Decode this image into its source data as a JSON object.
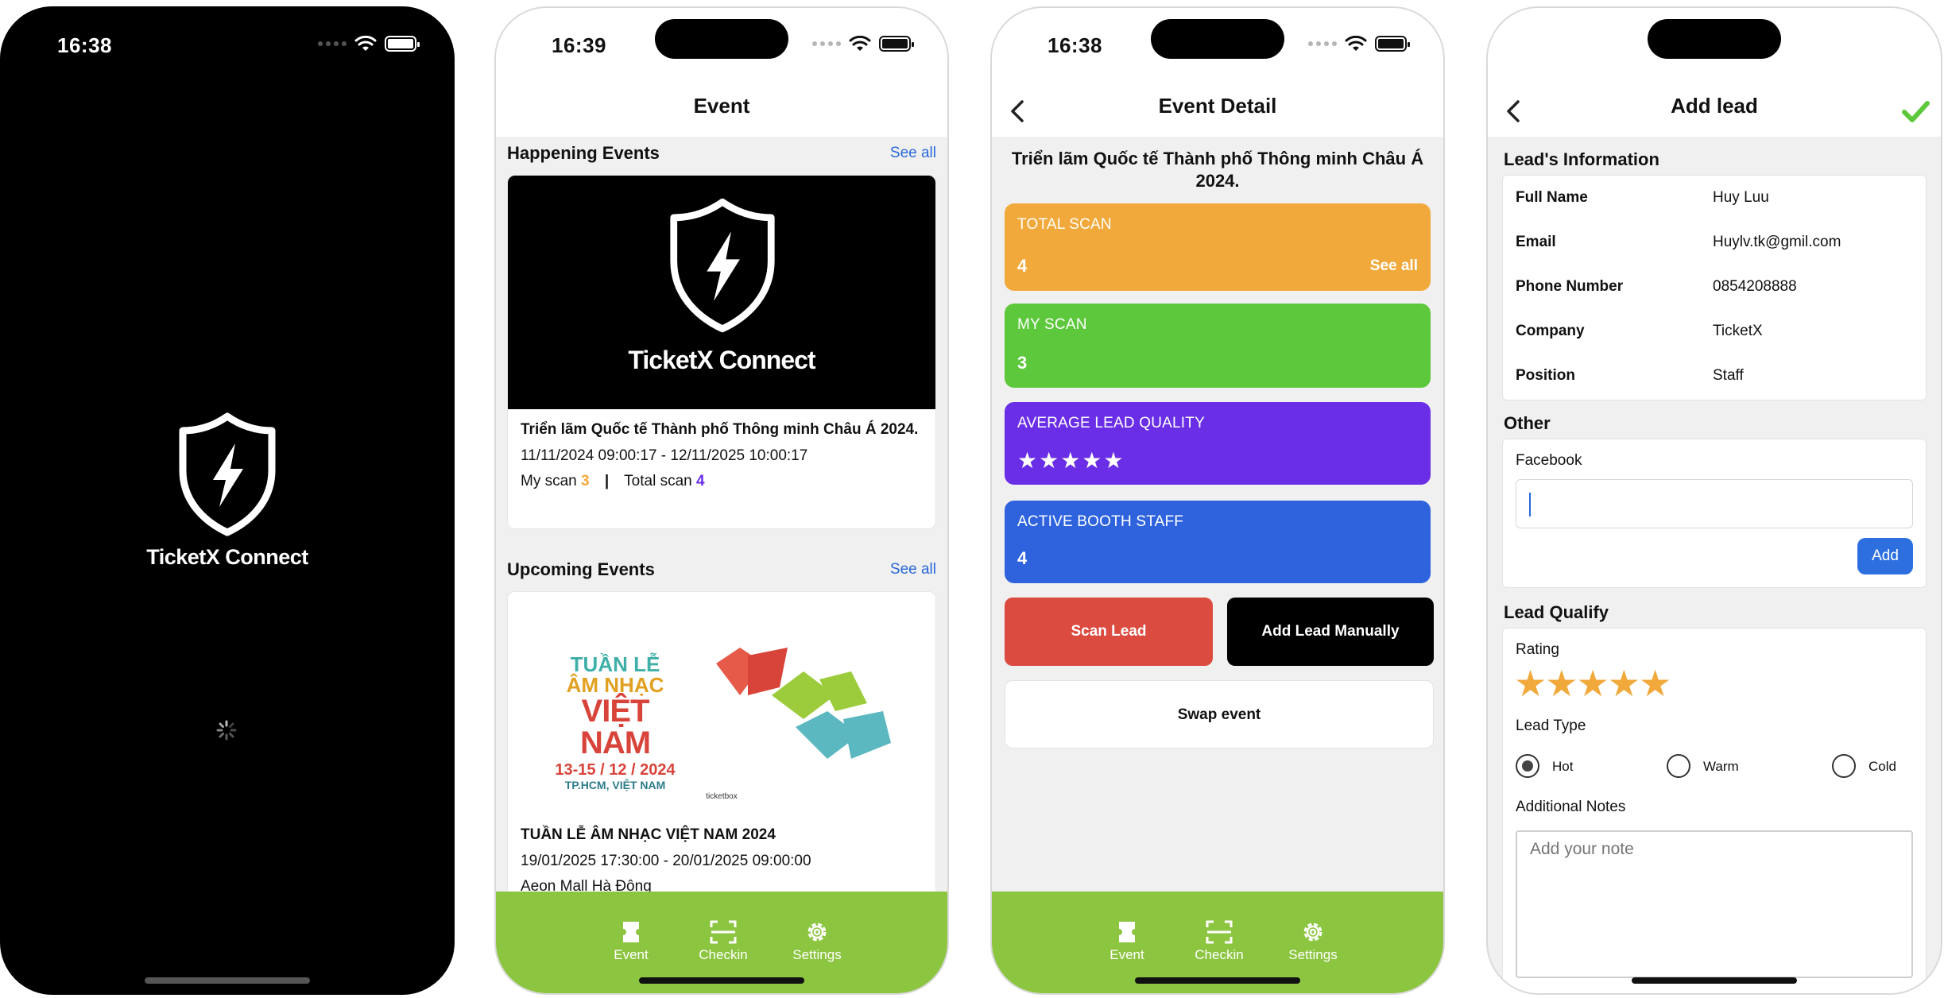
{
  "screen1": {
    "time": "16:38",
    "brand": "TicketX Connect"
  },
  "screen2": {
    "time": "16:39",
    "title": "Event",
    "happening": {
      "heading": "Happening Events",
      "see_all": "See all",
      "banner_brand": "TicketX Connect",
      "event_name": "Triển lãm Quốc tế Thành phố Thông minh Châu Á 2024.",
      "datetime": "11/11/2024 09:00:17 - 12/11/2025 10:00:17",
      "my_scan_label": "My scan",
      "my_scan_value": "3",
      "total_scan_label": "Total scan",
      "total_scan_value": "4",
      "separator": "|"
    },
    "upcoming": {
      "heading": "Upcoming Events",
      "see_all": "See all",
      "poster_line1": "TUẦN LỄ",
      "poster_line2": "ÂM NHẠC",
      "poster_line3": "VIỆT NAM",
      "poster_dates": "13-15 / 12 / 2024",
      "poster_place": "TP.HCM, VIỆT NAM",
      "poster_small": "ticketbox",
      "event_name": "TUẦN LỄ ÂM NHẠC VIỆT NAM 2024",
      "datetime": "19/01/2025 17:30:00 - 20/01/2025 09:00:00",
      "location_partial": "Aeon Mall Hà Đông"
    },
    "tabs": [
      {
        "label": "Event",
        "icon": "ticket-icon"
      },
      {
        "label": "Checkin",
        "icon": "scan-icon"
      },
      {
        "label": "Settings",
        "icon": "gear-icon"
      }
    ]
  },
  "screen3": {
    "time": "16:38",
    "title": "Event Detail",
    "event_name": "Triển lãm Quốc tế Thành phố Thông minh Châu Á 2024.",
    "total_scan": {
      "label": "TOTAL SCAN",
      "value": "4",
      "see_all": "See all",
      "color": "#f2a93b"
    },
    "my_scan": {
      "label": "MY SCAN",
      "value": "3",
      "color": "#5dc83c"
    },
    "avg_quality": {
      "label": "AVERAGE LEAD QUALITY",
      "stars": "★★★★★",
      "rating": 5,
      "color": "#6a2ee6"
    },
    "booth_staff": {
      "label": "ACTIVE BOOTH STAFF",
      "value": "4",
      "color": "#2e63dd"
    },
    "scan_lead": "Scan Lead",
    "add_manual": "Add Lead Manually",
    "swap_event": "Swap event",
    "tabs": [
      {
        "label": "Event",
        "icon": "ticket-icon"
      },
      {
        "label": "Checkin",
        "icon": "scan-icon"
      },
      {
        "label": "Settings",
        "icon": "gear-icon"
      }
    ]
  },
  "screen4": {
    "title": "Add lead",
    "info_heading": "Lead's Information",
    "info": [
      {
        "key": "Full Name",
        "value": "Huy Luu"
      },
      {
        "key": "Email",
        "value": "Huylv.tk@gmil.com"
      },
      {
        "key": "Phone Number",
        "value": "0854208888"
      },
      {
        "key": "Company",
        "value": "TicketX"
      },
      {
        "key": "Position",
        "value": "Staff"
      }
    ],
    "other_heading": "Other",
    "facebook_label": "Facebook",
    "facebook_value": "",
    "add_button": "Add",
    "qualify_heading": "Lead Qualify",
    "rating_label": "Rating",
    "rating_stars": "★★★★★",
    "rating": 5,
    "lead_type_label": "Lead Type",
    "lead_types": [
      "Hot",
      "Warm",
      "Cold"
    ],
    "lead_type_selected": "Hot",
    "notes_label": "Additional Notes",
    "notes_placeholder": "Add your note"
  }
}
